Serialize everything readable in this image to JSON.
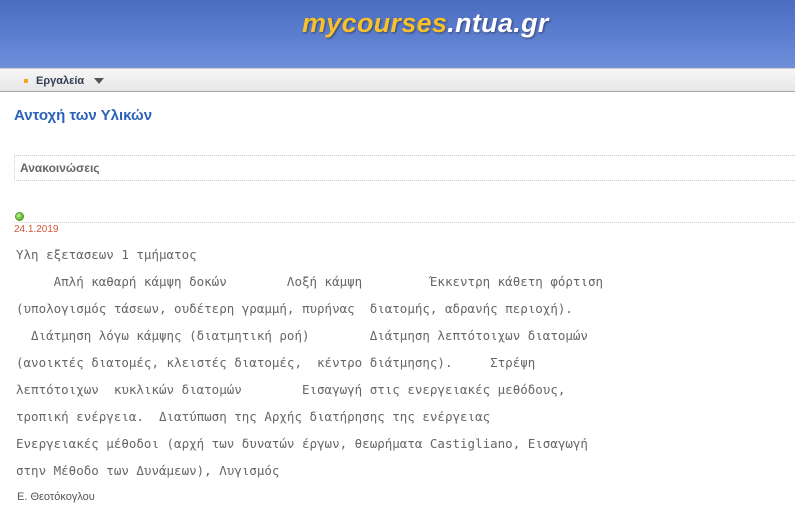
{
  "header": {
    "logo_part1": "mycourses",
    "logo_part2": ".ntua.gr"
  },
  "toolbar": {
    "tools_label": "Εργαλεία"
  },
  "course": {
    "title": "Αντοχή των Υλικών"
  },
  "section": {
    "title": "Ανακοινώσεις"
  },
  "announcement": {
    "date": "24.1.2019",
    "lines": [
      "Υλη εξετασεων 1 τμήματος",
      "     Απλή καθαρή κάμψη δοκών        Λοξή κάμψη         Έκκεντρη κάθετη φόρτιση",
      "(υπολογισμός τάσεων, ουδέτερη γραμμή, πυρήνας  διατομής, αδρανής περιοχή).",
      "  Διάτμηση λόγω κάμψης (διατμητική ροή)        Διάτμηση λεπτότοιχων διατομών",
      "(ανοικτές διατομές, κλειστές διατομές,  κέντρο διάτμησης).     Στρέψη",
      "λεπτότοιχων  κυκλικών διατομών        Εισαγωγή στις ενεργειακές μεθόδους,",
      "τροπική ενέργεια.  Διατύπωση της Αρχής διατήρησης της ενέργειας",
      "Ενεργειακές μέθοδοι (αρχή των δυνατών έργων, θεωρήματα Castigliano, Εισαγωγή",
      "στην Μέθοδο των Δυνάμεων), Λυγισμός"
    ],
    "author": "Ε. Θεοτόκογλου"
  },
  "colors": {
    "header_blue": "#5576c9",
    "logo_orange": "#f6c12b",
    "title_blue": "#2a63b8",
    "date_red": "#d05a3a",
    "status_green": "#6cc53e"
  },
  "icons": [
    "bullet-icon",
    "chevron-down-icon",
    "status-dot-icon"
  ]
}
